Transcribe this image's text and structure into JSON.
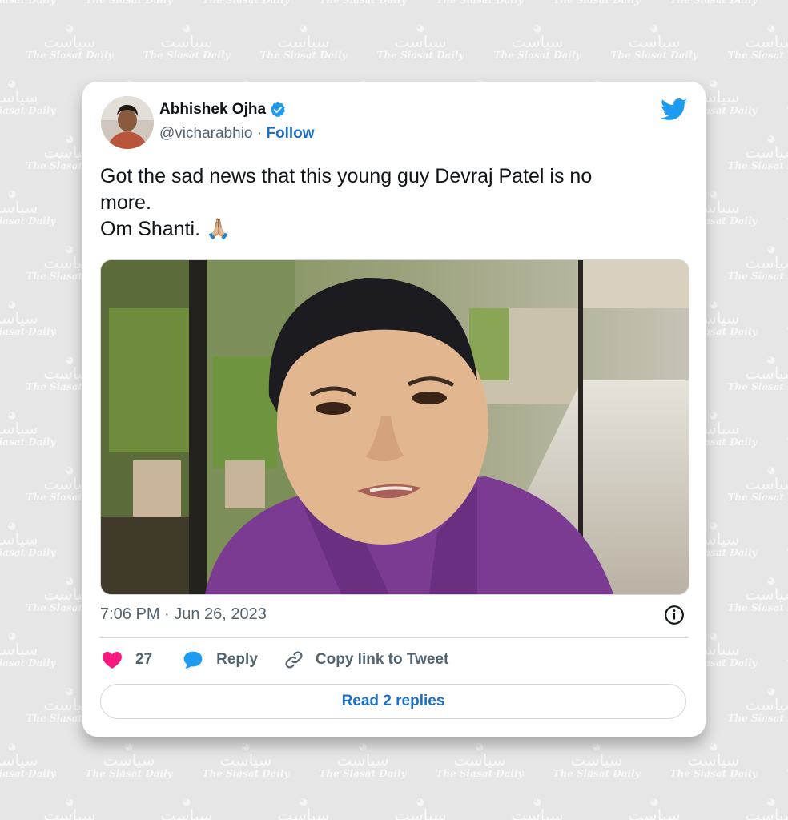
{
  "watermark": {
    "urdu": "سیاست",
    "english": "The Siasat Daily"
  },
  "tweet": {
    "author_name": "Abhishek Ojha",
    "handle": "@vicharabhio",
    "separator": "·",
    "follow_label": "Follow",
    "text_lines": [
      "Got the sad news that this young guy Devraj Patel is no",
      "more.",
      "Om Shanti. 🙏🏼"
    ],
    "timestamp": "7:06 PM · Jun 26, 2023",
    "like_count": "27",
    "reply_label": "Reply",
    "copy_link_label": "Copy link to Tweet",
    "read_replies_label": "Read 2 replies"
  },
  "colors": {
    "twitter_blue": "#1d9bf0",
    "like_pink": "#f91880",
    "link_blue": "#1d6fc4",
    "background": "#e6e6e6"
  },
  "icons": [
    "verified-badge-icon",
    "twitter-bird-icon",
    "info-icon",
    "heart-icon",
    "reply-bubble-icon",
    "link-icon"
  ]
}
